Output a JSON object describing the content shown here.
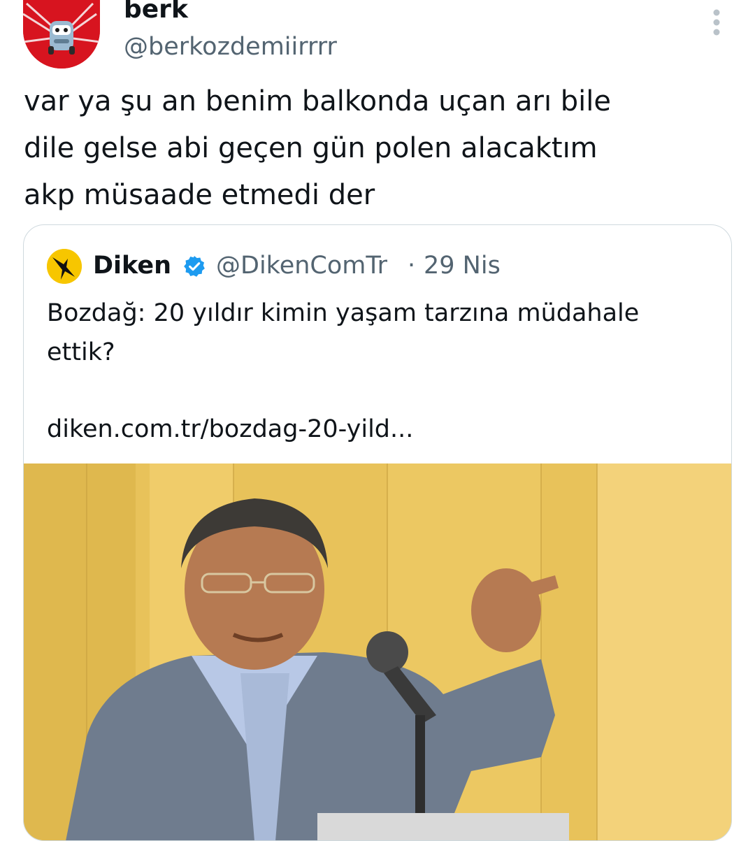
{
  "tweet": {
    "display_name": "berk",
    "handle": "@berkozdemiirrrr",
    "text_lines": [
      "var ya şu an benim balkonda uçan arı bile",
      "dile gelse abi geçen gün polen alacaktım",
      "akp müsaade etmedi der"
    ],
    "avatar_icon": "cartoon-car-on-red-avatar",
    "more_icon": "more-vertical-icon"
  },
  "quoted": {
    "display_name": "Diken",
    "verified_icon": "verified-badge-icon",
    "handle": "@DikenComTr",
    "separator": "·",
    "date": "29 Nis",
    "text_lines": [
      "Bozdağ: 20 yıldır kimin yaşam tarzına müdahale",
      "ettik?"
    ],
    "link": "diken.com.tr/bozdag-20-yild...",
    "avatar_icon": "diken-bird-logo",
    "image_icon": "speaker-pointing-at-microphone-photo"
  },
  "colors": {
    "text": "#0f1419",
    "secondary_text": "#536471",
    "verified": "#1d9bf0",
    "avatar_red": "#d7141f",
    "diken_yellow": "#f7c600",
    "photo_background": "#e8c25a"
  }
}
